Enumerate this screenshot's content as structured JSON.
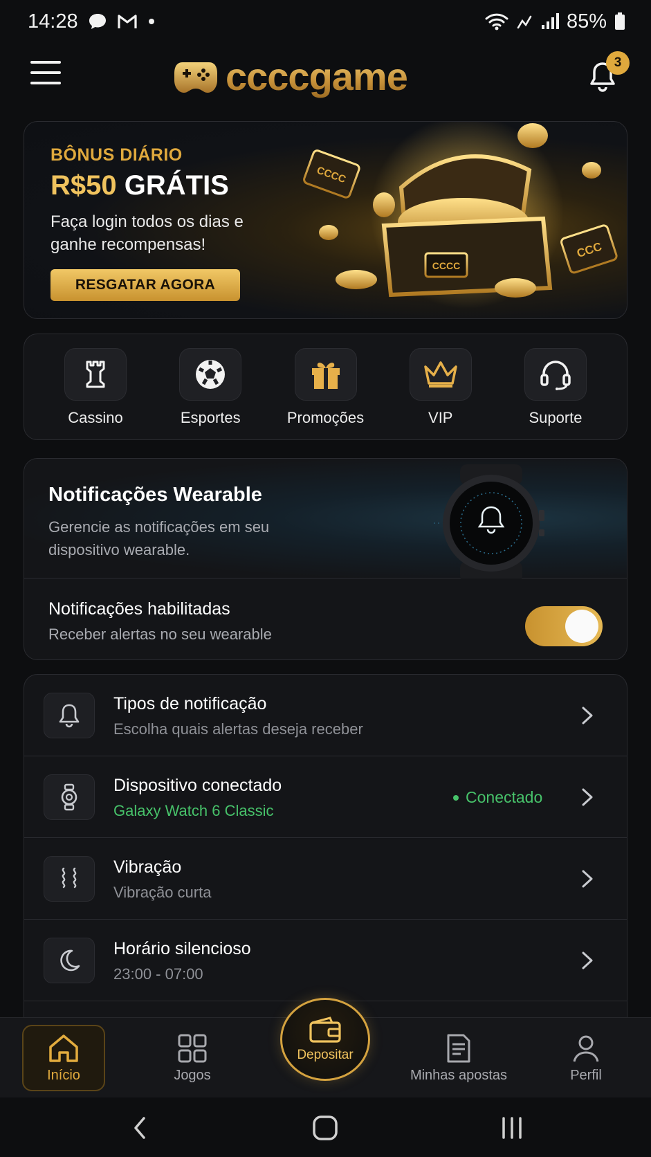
{
  "status_bar": {
    "time": "14:28",
    "battery": "85%"
  },
  "header": {
    "brand": "ccccgame",
    "notification_count": "3"
  },
  "banner": {
    "eyebrow": "BÔNUS DIÁRIO",
    "title_gold": "R$50",
    "title_white": "GRÁTIS",
    "text": "Faça login todos os dias e ganhe recompensas!",
    "cta": "RESGATAR AGORA",
    "art_text_1": "CCCC",
    "art_text_2": "CCC",
    "art_text_3": "CCCC"
  },
  "quick_nav": [
    {
      "label": "Cassino",
      "icon": "rook-icon"
    },
    {
      "label": "Esportes",
      "icon": "soccer-ball-icon"
    },
    {
      "label": "Promoções",
      "icon": "gift-icon"
    },
    {
      "label": "VIP",
      "icon": "crown-icon"
    },
    {
      "label": "Suporte",
      "icon": "headset-icon"
    }
  ],
  "wearable": {
    "title": "Notificações Wearable",
    "description": "Gerencie as notificações em seu dispositivo wearable.",
    "toggle_title": "Notificações habilitadas",
    "toggle_subtitle": "Receber alertas no seu wearable",
    "toggle_on": true
  },
  "settings": [
    {
      "title": "Tipos de notificação",
      "subtitle": "Escolha quais alertas deseja receber",
      "icon": "bell-icon"
    },
    {
      "title": "Dispositivo conectado",
      "subtitle": "Galaxy Watch 6 Classic",
      "status": "Conectado",
      "icon": "watch-icon"
    },
    {
      "title": "Vibração",
      "subtitle": "Vibração curta",
      "icon": "vibration-icon"
    },
    {
      "title": "Horário silencioso",
      "subtitle": "23:00 - 07:00",
      "icon": "moon-icon"
    }
  ],
  "bottom_nav": {
    "home": "Início",
    "games": "Jogos",
    "deposit": "Depositar",
    "bets": "Minhas apostas",
    "profile": "Perfil"
  },
  "colors": {
    "accent": "#e0a93d",
    "success": "#47c26a",
    "background": "#0d0e10",
    "card": "#141518"
  }
}
